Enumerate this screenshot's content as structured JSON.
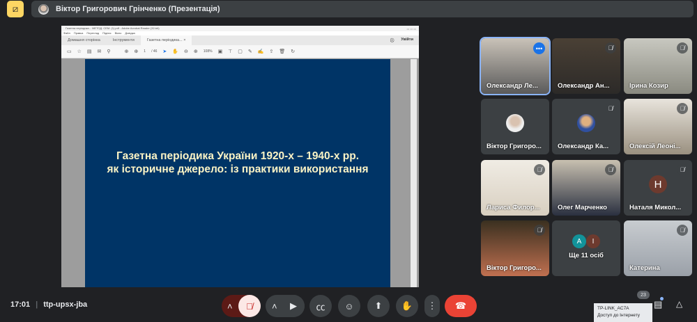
{
  "header": {
    "presenter": "Віктор Григорович Грінченко (Презентація)",
    "present_icon": "presentation-off-icon"
  },
  "acrobat": {
    "window_title": "Газетна періодика... МЕТОД. СЕМ. (1).pdf - Adobe Acrobat Reader (32-bit)",
    "menu": [
      "Файл",
      "Правка",
      "Перегляд",
      "Підпис",
      "Вікно",
      "Довідка"
    ],
    "tabs": [
      "Домашня сторінка",
      "Інструменти",
      "Газетна періодика..."
    ],
    "sign_in": "Увійти",
    "page_current": "1",
    "page_total": "/ 46",
    "zoom": "108%"
  },
  "slide": {
    "line1": "Газетна періодика України 1920-х – 1940-х рр.",
    "line2": "як історичне джерело: із практики використання"
  },
  "participants": [
    {
      "name": "Олександр Ле...",
      "muted": false
    },
    {
      "name": "Олександр Ан...",
      "muted": true
    },
    {
      "name": "Ірина Козир",
      "muted": true
    },
    {
      "name": "Віктор Григоро...",
      "muted": false
    },
    {
      "name": "Олександр Ка...",
      "muted": true
    },
    {
      "name": "Олексій Леоні...",
      "muted": true
    },
    {
      "name": "Лариса Филор...",
      "muted": true
    },
    {
      "name": "Олег Марченко",
      "muted": true
    },
    {
      "name": "Наталя Микол...",
      "muted": true,
      "initial": "Н"
    },
    {
      "name": "Віктор Григоро...",
      "muted": true
    },
    {
      "name": "Ще 11 осіб",
      "initials": [
        "А",
        "І"
      ]
    },
    {
      "name": "Катерина",
      "muted": true
    }
  ],
  "footer": {
    "time": "17:01",
    "meeting_code": "ttp-upsx-jba",
    "people_count": "23",
    "wifi_name": "TP-LINK_AC7A",
    "wifi_status": "Доступ до Інтернету"
  },
  "colors": {
    "end_call": "#ea4335",
    "mic_off": "#fce8e6",
    "selected": "#8ab4f8",
    "present": "#fdd663"
  }
}
